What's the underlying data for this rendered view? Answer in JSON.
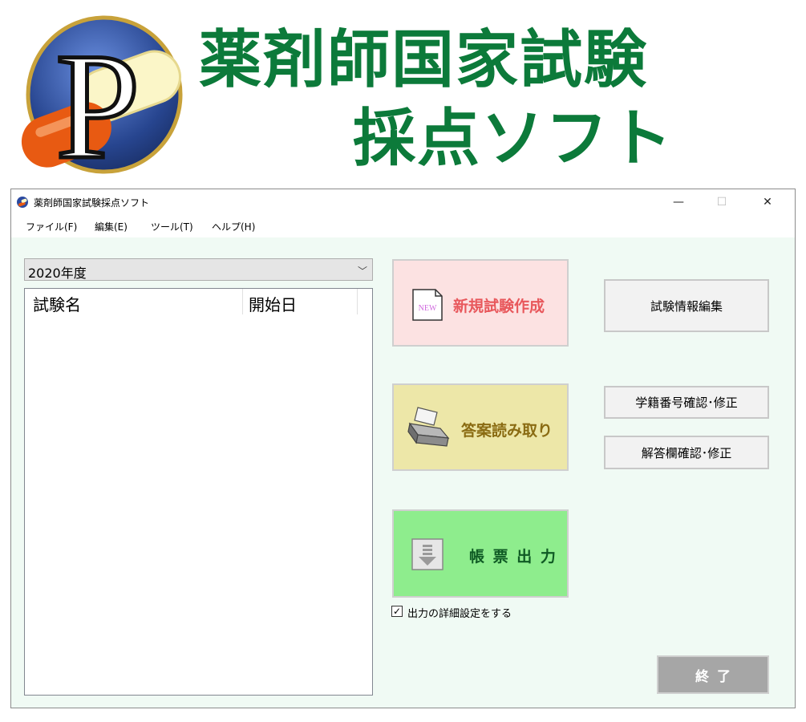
{
  "banner": {
    "logo_letter": "P",
    "line1": "薬剤師国家試験",
    "line2": "採点ソフト"
  },
  "window": {
    "title": "薬剤師国家試験採点ソフト",
    "controls": {
      "minimize": "—",
      "maximize": "☐",
      "close": "✕"
    }
  },
  "menu": {
    "items": [
      {
        "label": "ファイル(F)"
      },
      {
        "label": "編集(E)"
      },
      {
        "label": "ツール(T)"
      },
      {
        "label": "ヘルプ(H)"
      }
    ]
  },
  "year_select": {
    "value": "2020年度",
    "arrow": "﹀"
  },
  "exam_list": {
    "columns": [
      "試験名",
      "開始日"
    ],
    "rows": []
  },
  "actions": {
    "new_exam": {
      "label": "新規試験作成",
      "icon_text": "NEW",
      "color": "#e8585c"
    },
    "read_answers": {
      "label": "答案読み取り",
      "color": "#8a6b12"
    },
    "output": {
      "label": "帳 票 出 力",
      "color": "#0f5a24"
    }
  },
  "side_buttons": {
    "exam_info": "試験情報編集",
    "student_check": "学籍番号確認･修正",
    "answer_check": "解答欄確認･修正"
  },
  "output_option": {
    "label": "出力の詳細設定をする",
    "checked": true,
    "check_mark": "✓"
  },
  "end_button": {
    "label": "終了"
  },
  "colors": {
    "banner_green": "#0c7a3a",
    "window_bg": "#f0faf4",
    "new_bg": "#fce2e2",
    "read_bg": "#ede7a8",
    "output_bg": "#8eed8d",
    "end_bg": "#a6a6a6"
  }
}
